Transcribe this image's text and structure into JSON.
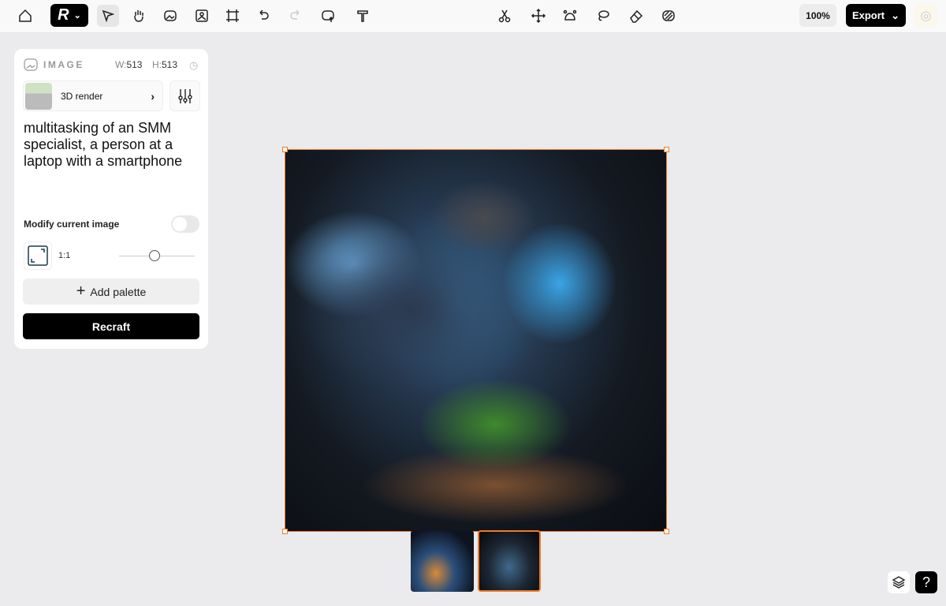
{
  "toolbar": {
    "logo": "R",
    "zoom": "100%",
    "export_label": "Export",
    "tools": [
      "home-icon",
      "pointer-icon",
      "hand-icon",
      "image-generate-icon",
      "image-frame-icon",
      "frame-icon",
      "undo-icon",
      "redo-icon",
      "image-upload-icon",
      "text-icon",
      "scissors-icon",
      "move-icon",
      "vectorize-icon",
      "lasso-icon",
      "eraser-icon",
      "pattern-icon"
    ]
  },
  "panel": {
    "type_label": "IMAGE",
    "w_label": "W:",
    "w_value": "513",
    "h_label": "H:",
    "h_value": "513",
    "style_name": "3D render",
    "prompt": "multitasking of an SMM specialist, a person at a laptop with a smartphone",
    "modify_label": "Modify current image",
    "modify_on": false,
    "ratio": "1:1",
    "palette_label": "Add palette",
    "recraft_label": "Recraft"
  },
  "colors": {
    "accent": "#f07a2a",
    "primary": "#000000"
  },
  "thumbnails": {
    "count": 2,
    "selected": 2
  }
}
